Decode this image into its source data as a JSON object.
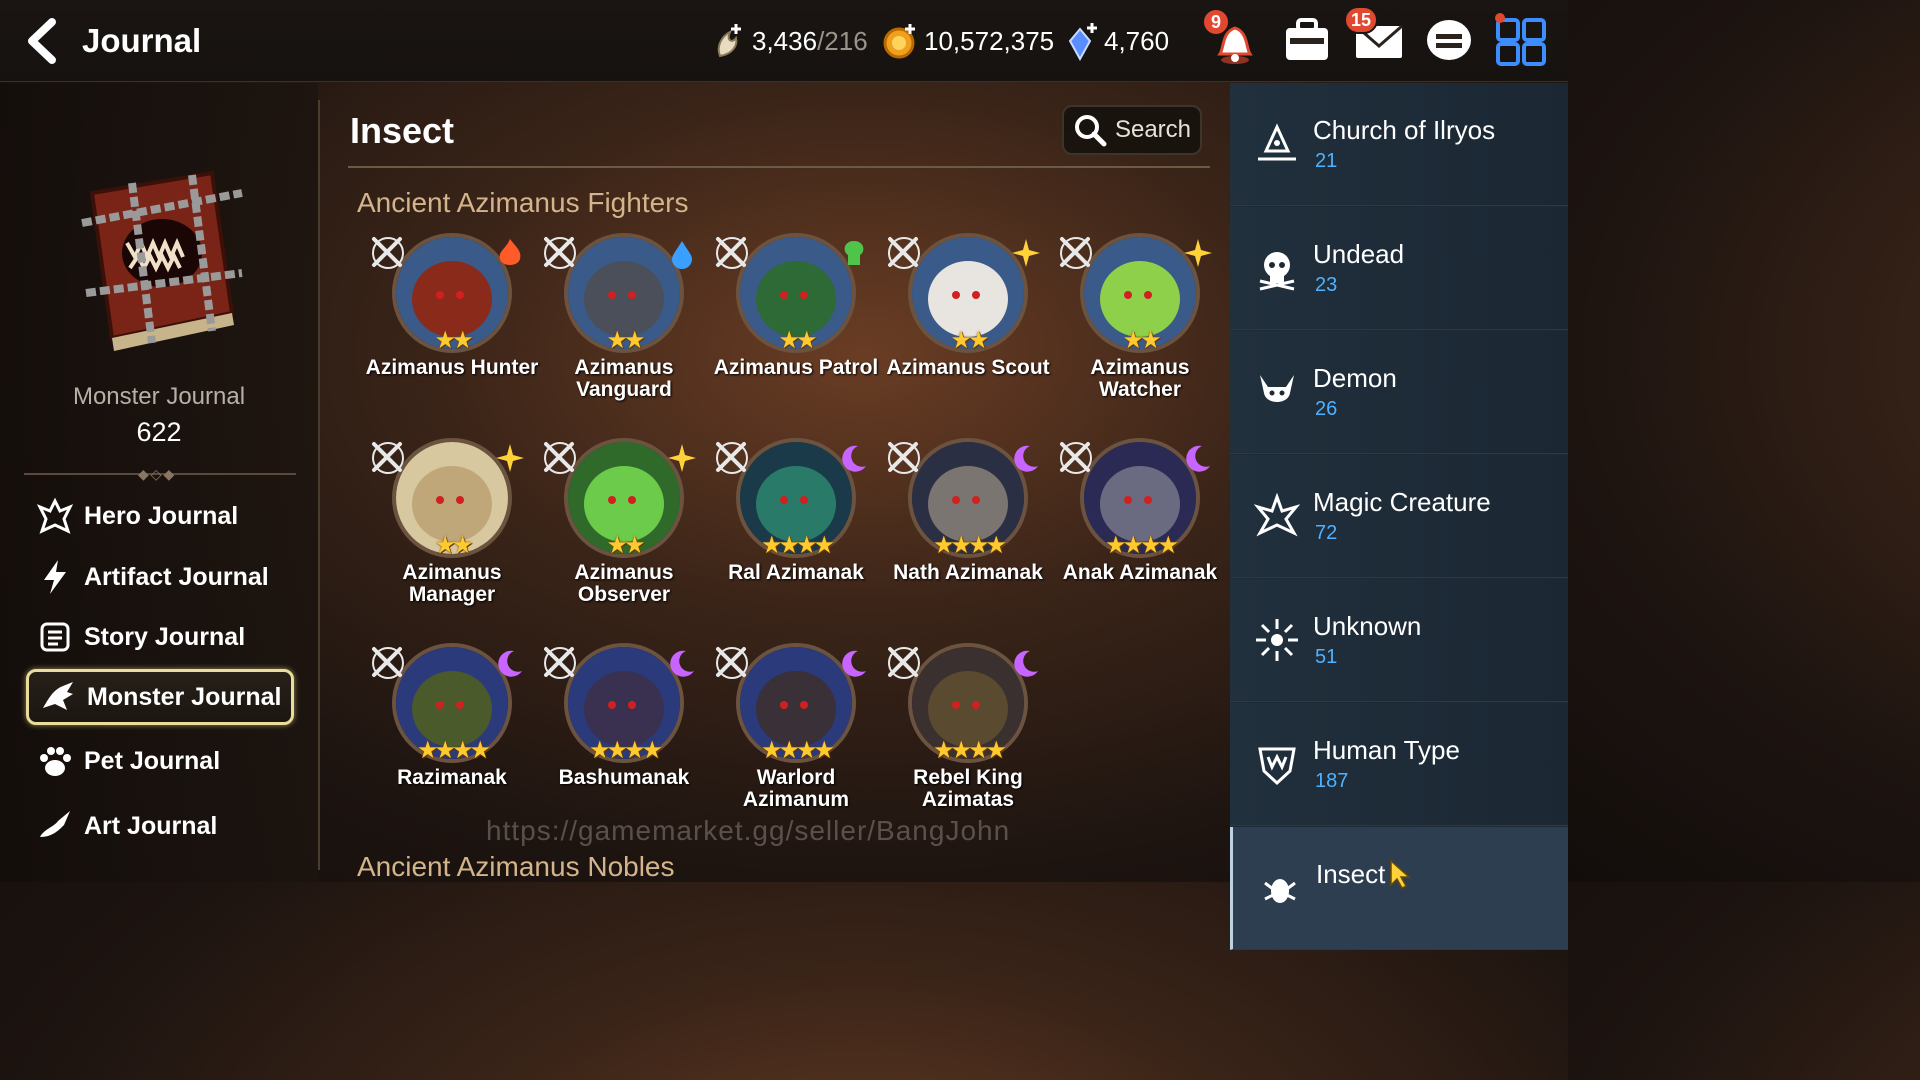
{
  "header": {
    "title": "Journal",
    "stamina": {
      "current": "3,436",
      "max": "/216"
    },
    "gold": "10,572,375",
    "crystals": "4,760",
    "notifications_badge": "9",
    "mail_badge": "15"
  },
  "left_panel": {
    "journal_label": "Monster Journal",
    "journal_count": "622",
    "nav": [
      {
        "label": "Hero Journal",
        "icon": "hero-icon"
      },
      {
        "label": "Artifact Journal",
        "icon": "lightning-icon"
      },
      {
        "label": "Story Journal",
        "icon": "scroll-icon"
      },
      {
        "label": "Monster Journal",
        "icon": "dragon-icon",
        "active": true
      },
      {
        "label": "Pet Journal",
        "icon": "paw-icon"
      },
      {
        "label": "Art Journal",
        "icon": "brush-icon"
      }
    ]
  },
  "main": {
    "title": "Insect",
    "search_label": "Search",
    "group1_title": "Ancient Azimanus Fighters",
    "group2_title": "Ancient Azimanus Nobles",
    "watermark": "https://gamemarket.gg/seller/BangJohn",
    "monsters": [
      {
        "name": "Azimanus Hunter",
        "stars": "★★",
        "element": "fire"
      },
      {
        "name": "Azimanus Vanguard",
        "stars": "★★",
        "element": "ice"
      },
      {
        "name": "Azimanus Patrol",
        "stars": "★★",
        "element": "earth"
      },
      {
        "name": "Azimanus Scout",
        "stars": "★★",
        "element": "light"
      },
      {
        "name": "Azimanus Watcher",
        "stars": "★★",
        "element": "light"
      },
      {
        "name": "Azimanus Manager",
        "stars": "★★",
        "element": "light"
      },
      {
        "name": "Azimanus Observer",
        "stars": "★★",
        "element": "light"
      },
      {
        "name": "Ral Azimanak",
        "stars": "★★★★",
        "element": "dark"
      },
      {
        "name": "Nath Azimanak",
        "stars": "★★★★",
        "element": "dark"
      },
      {
        "name": "Anak Azimanak",
        "stars": "★★★★",
        "element": "dark"
      },
      {
        "name": "Razimanak",
        "stars": "★★★★",
        "element": "dark"
      },
      {
        "name": "Bashumanak",
        "stars": "★★★★",
        "element": "dark"
      },
      {
        "name": "Warlord Azimanum",
        "stars": "★★★★",
        "element": "dark"
      },
      {
        "name": "Rebel King Azimatas",
        "stars": "★★★★",
        "element": "dark"
      }
    ]
  },
  "categories": [
    {
      "name": "Church of Ilryos",
      "count": "21",
      "icon": "church-icon"
    },
    {
      "name": "Undead",
      "count": "23",
      "icon": "skull-icon"
    },
    {
      "name": "Demon",
      "count": "26",
      "icon": "demon-icon"
    },
    {
      "name": "Magic Creature",
      "count": "72",
      "icon": "magic-creature-icon"
    },
    {
      "name": "Unknown",
      "count": "51",
      "icon": "unknown-icon"
    },
    {
      "name": "Human Type",
      "count": "187",
      "icon": "human-icon"
    },
    {
      "name": "Insect",
      "count": "",
      "icon": "insect-icon",
      "active": true
    }
  ],
  "colors": {
    "accent_gold": "#d4b48a",
    "count_blue": "#4fb2ff",
    "star_yellow": "#ffc930",
    "badge_red": "#e0482f"
  }
}
